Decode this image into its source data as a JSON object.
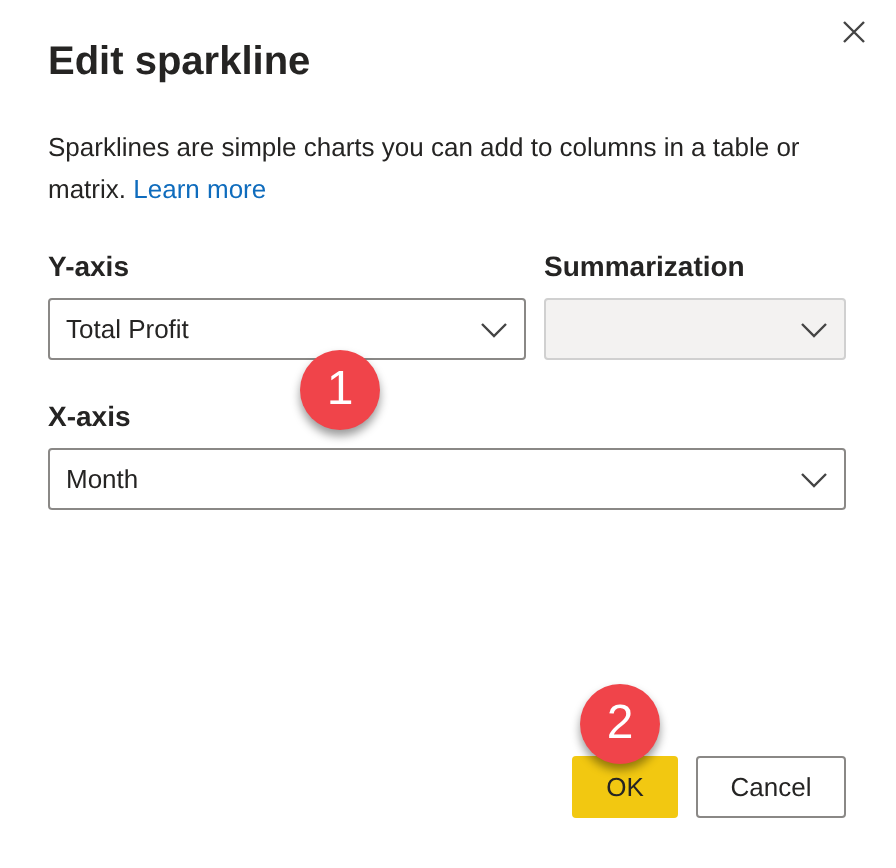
{
  "dialog": {
    "title": "Edit sparkline",
    "description": "Sparklines are simple charts you can add to columns in a table or matrix.",
    "link": "Learn more"
  },
  "fields": [
    {
      "label": "Y-axis",
      "value": "Total Profit",
      "disabled": false
    },
    {
      "label": "Summarization",
      "disabled": true
    },
    {
      "label": "X-axis",
      "value": "Month",
      "disabled": false
    }
  ],
  "buttons": [
    {
      "label": "OK",
      "kind": "primary"
    },
    {
      "label": "Cancel",
      "kind": "secondary"
    }
  ],
  "callouts": [
    "1",
    "2"
  ]
}
